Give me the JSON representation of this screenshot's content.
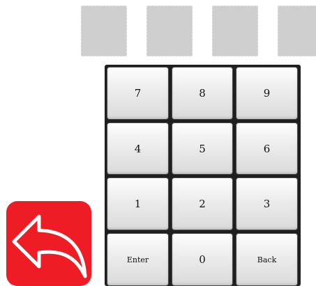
{
  "pin_display": {
    "slots": [
      "",
      "",
      "",
      ""
    ]
  },
  "keypad": {
    "keys": [
      "7",
      "8",
      "9",
      "4",
      "5",
      "6",
      "1",
      "2",
      "3",
      "Enter",
      "0",
      "Back"
    ]
  },
  "icons": {
    "return_button": "curved-back-arrow-icon"
  },
  "colors": {
    "return_button_bg": "#ee1c25",
    "pin_slot": "#cfcfcf",
    "key_face": "#e6e6e6",
    "keypad_frame": "#1f1f1f"
  }
}
